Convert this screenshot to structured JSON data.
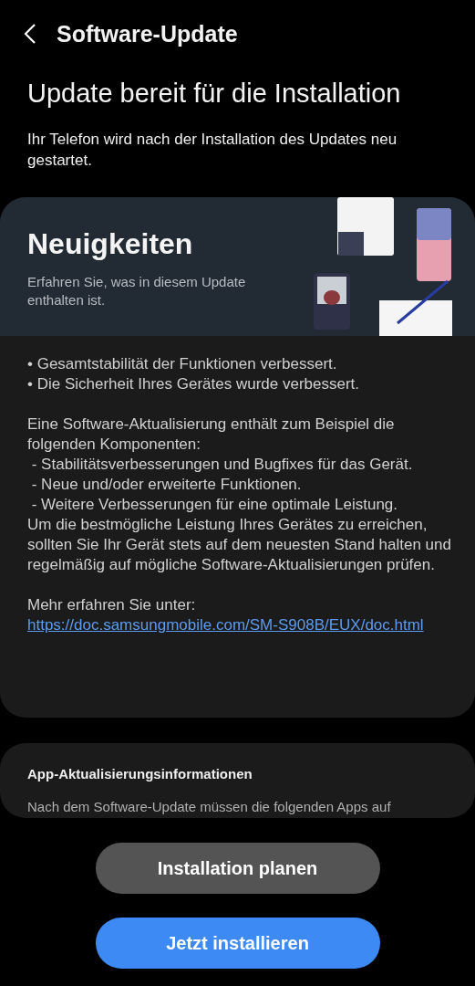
{
  "header": {
    "title": "Software-Update"
  },
  "headline": "Update bereit für die Installation",
  "subtitle": "Ihr Telefon wird nach der Installation des Updates neu gestartet.",
  "news_card": {
    "banner": {
      "title": "Neuigkeiten",
      "subtitle": "Erfahren Sie, was in diesem Update enthalten ist.",
      "kind": "picture"
    },
    "bullets": [
      "• Gesamtstabilität der Funktionen verbessert.",
      "• Die Sicherheit Ihres Gerätes wurde verbessert."
    ],
    "intro": "Eine Software-Aktualisierung enthält zum Beispiel die folgenden Komponenten:",
    "components": [
      " - Stabilitätsverbesserungen und Bugfixes für das Gerät.",
      " - Neue und/oder erweiterte Funktionen.",
      " - Weitere Verbesserungen für eine optimale Leistung."
    ],
    "closing": "Um die bestmögliche Leistung Ihres Gerätes zu erreichen, sollten Sie Ihr Gerät stets auf dem neuesten Stand halten und regelmäßig auf mögliche Software-Aktualisierungen prüfen.",
    "more_label": "Mehr erfahren Sie unter:",
    "link": "https://doc.samsungmobile.com/SM-S908B/EUX/doc.html"
  },
  "app_card": {
    "title": "App-Aktualisierungsinformationen",
    "text": "Nach dem Software-Update müssen die folgenden Apps auf"
  },
  "buttons": [
    {
      "label": "Installation planen",
      "kind": "secondary"
    },
    {
      "label": "Jetzt installieren",
      "kind": "primary"
    }
  ]
}
